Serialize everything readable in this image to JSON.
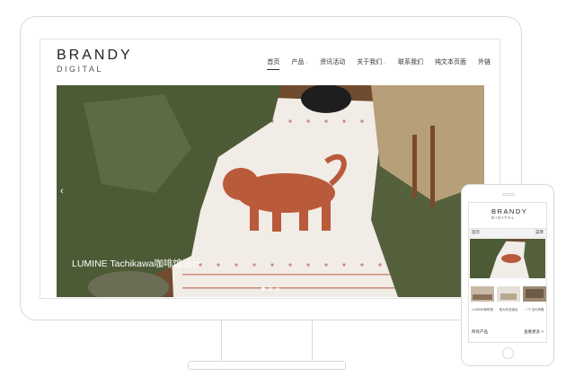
{
  "colors": {
    "frame": "#d9d9d9",
    "text": "#333333",
    "hero_caption": "#ffffff",
    "tiger": "#b95a3b"
  },
  "desktop": {
    "logo": {
      "brand": "BRANDY",
      "sub": "DIGITAL"
    },
    "nav": [
      {
        "label": "首页",
        "active": true,
        "dropdown": false
      },
      {
        "label": "产品",
        "active": false,
        "dropdown": true
      },
      {
        "label": "资讯活动",
        "active": false,
        "dropdown": false
      },
      {
        "label": "关于我们",
        "active": false,
        "dropdown": true
      },
      {
        "label": "联系我们",
        "active": false,
        "dropdown": false
      },
      {
        "label": "纯文本页面",
        "active": false,
        "dropdown": false
      },
      {
        "label": "外链",
        "active": false,
        "dropdown": false
      }
    ],
    "hero": {
      "caption": "LUMINE Tachikawa咖啡馆设计",
      "prev_icon": "chevron-left-icon",
      "slides_total": 3,
      "slide_active": 1
    }
  },
  "mobile": {
    "logo": {
      "brand": "BRANDY",
      "sub": "DIGITAL"
    },
    "bar": {
      "left": "首页",
      "right": "菜单"
    },
    "thumbs": [
      {
        "label": "LUMINE咖啡馆"
      },
      {
        "label": "澳大利亚酒店"
      },
      {
        "label": "一个当代风格"
      }
    ],
    "footer": {
      "left": "所有产品",
      "right": "查看更多 >"
    }
  }
}
